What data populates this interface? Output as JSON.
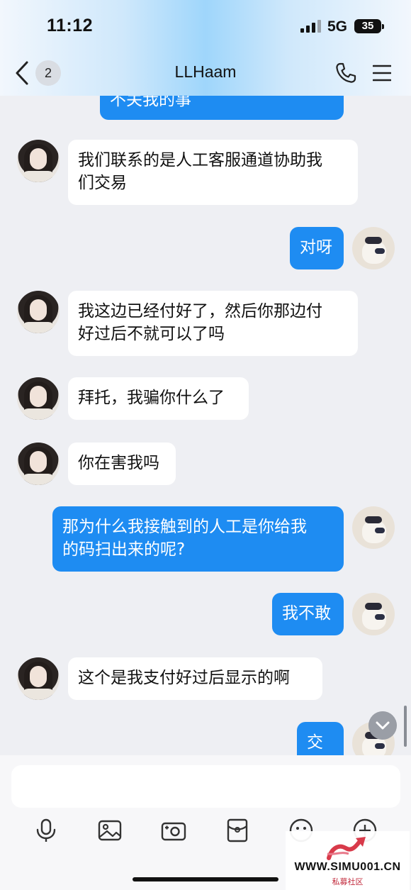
{
  "status_bar": {
    "time": "11:12",
    "network": "5G",
    "battery": "35"
  },
  "header": {
    "unread_count": "2",
    "title": "LLHaam",
    "icons": {
      "back": "chevron-left-icon",
      "call": "phone-icon",
      "menu": "hamburger-menu-icon"
    }
  },
  "messages": [
    {
      "side": "out",
      "text": "不关我的事"
    },
    {
      "side": "in",
      "text": "我们联系的是人工客服通道协助我\n们交易"
    },
    {
      "side": "out",
      "text": "对呀"
    },
    {
      "side": "in",
      "text": "我这边已经付好了，然后你那边付\n好过后不就可以了吗"
    },
    {
      "side": "in",
      "text": "拜托，我骗你什么了"
    },
    {
      "side": "in",
      "text": "你在害我吗"
    },
    {
      "side": "out",
      "text": "那为什么我接触到的人工是你给我\n的码扫出来的呢?"
    },
    {
      "side": "out",
      "text": "我不敢"
    },
    {
      "side": "in",
      "text": "这个是我支付好过后显示的啊"
    },
    {
      "side": "out",
      "text": "交"
    }
  ],
  "input": {
    "value": "",
    "placeholder": ""
  },
  "toolbar": [
    "microphone-icon",
    "image-icon",
    "camera-icon",
    "red-packet-icon",
    "emoji-icon",
    "plus-icon"
  ],
  "colors": {
    "outgoing_bubble": "#1e8cf2",
    "incoming_bubble": "#ffffff",
    "background": "#eeeff3"
  },
  "watermark": {
    "site": "WWW.SIMU001.CN",
    "subtitle": "私募社区"
  }
}
